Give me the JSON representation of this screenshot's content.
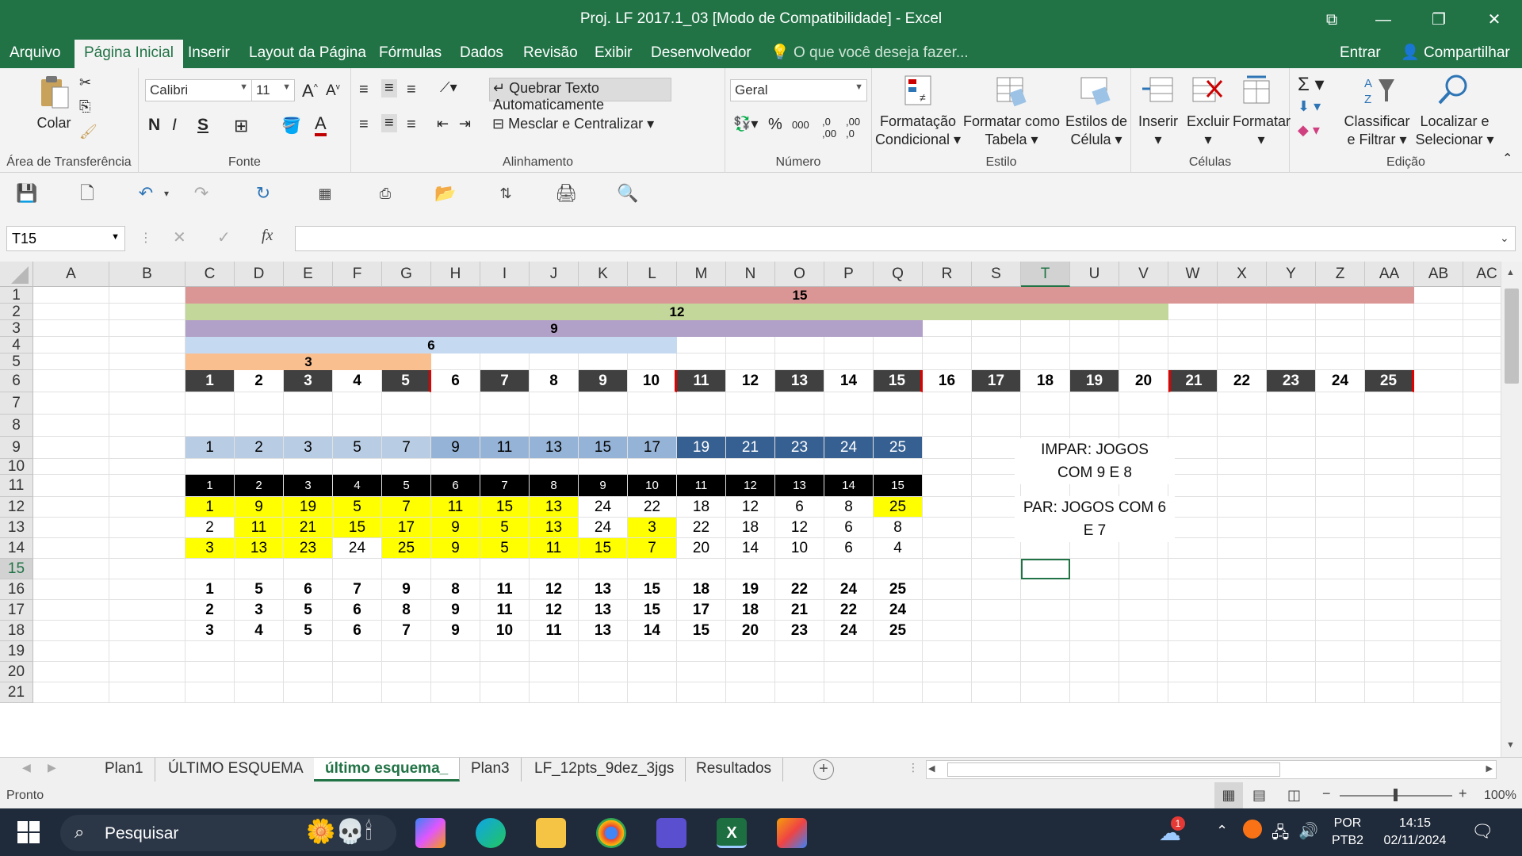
{
  "window": {
    "title": "Proj. LF 2017.1_03  [Modo de Compatibilidade] - Excel"
  },
  "menu": {
    "tabs": [
      "Arquivo",
      "Página Inicial",
      "Inserir",
      "Layout da Página",
      "Fórmulas",
      "Dados",
      "Revisão",
      "Exibir",
      "Desenvolvedor"
    ],
    "search": "O que você deseja fazer...",
    "signin": "Entrar",
    "share": "Compartilhar"
  },
  "ribbon": {
    "paste": "Colar",
    "clipboard_label": "Área de Transferência",
    "font_name": "Calibri",
    "font_size": "11",
    "bold": "N",
    "italic": "I",
    "underline": "S",
    "font_label": "Fonte",
    "wrap_text": "Quebrar Texto Automaticamente",
    "merge_center": "Mesclar e Centralizar",
    "align_label": "Alinhamento",
    "number_format": "Geral",
    "number_label": "Número",
    "cond_format_1": "Formatação",
    "cond_format_2": "Condicional",
    "format_table_1": "Formatar como",
    "format_table_2": "Tabela",
    "cell_styles_1": "Estilos de",
    "cell_styles_2": "Célula",
    "style_label": "Estilo",
    "insert": "Inserir",
    "delete": "Excluir",
    "format": "Formatar",
    "cells_label": "Células",
    "sort_1": "Classificar",
    "sort_2": "e Filtrar",
    "find_1": "Localizar e",
    "find_2": "Selecionar",
    "edit_label": "Edição"
  },
  "formula_bar": {
    "name_box": "T15",
    "fx": "fx",
    "value": ""
  },
  "columns": [
    "A",
    "B",
    "C",
    "D",
    "E",
    "F",
    "G",
    "H",
    "I",
    "J",
    "K",
    "L",
    "M",
    "N",
    "O",
    "P",
    "Q",
    "R",
    "S",
    "T",
    "U",
    "V",
    "W",
    "X",
    "Y",
    "Z",
    "AA",
    "AB",
    "AC"
  ],
  "rows": [
    "1",
    "2",
    "3",
    "4",
    "5",
    "6",
    "7",
    "8",
    "9",
    "10",
    "11",
    "12",
    "13",
    "14",
    "15",
    "16",
    "17",
    "18",
    "19",
    "20",
    "21"
  ],
  "bars": {
    "r1": "15",
    "r2": "12",
    "r3": "9",
    "r4": "6",
    "r5": "3"
  },
  "row6": [
    "1",
    "2",
    "3",
    "4",
    "5",
    "6",
    "7",
    "8",
    "9",
    "10",
    "11",
    "12",
    "13",
    "14",
    "15",
    "16",
    "17",
    "18",
    "19",
    "20",
    "21",
    "22",
    "23",
    "24",
    "25"
  ],
  "row9": [
    "1",
    "2",
    "3",
    "5",
    "7",
    "9",
    "11",
    "13",
    "15",
    "17",
    "19",
    "21",
    "23",
    "24",
    "25"
  ],
  "row11": [
    "1",
    "2",
    "3",
    "4",
    "5",
    "6",
    "7",
    "8",
    "9",
    "10",
    "11",
    "12",
    "13",
    "14",
    "15"
  ],
  "row12": [
    "1",
    "9",
    "19",
    "5",
    "7",
    "11",
    "15",
    "13",
    "24",
    "22",
    "18",
    "12",
    "6",
    "8",
    "25"
  ],
  "row13": [
    "2",
    "11",
    "21",
    "15",
    "17",
    "9",
    "5",
    "13",
    "24",
    "3",
    "22",
    "18",
    "12",
    "6",
    "8"
  ],
  "row14": [
    "3",
    "13",
    "23",
    "24",
    "25",
    "9",
    "5",
    "11",
    "15",
    "7",
    "20",
    "14",
    "10",
    "6",
    "4"
  ],
  "row16": [
    "1",
    "5",
    "6",
    "7",
    "9",
    "8",
    "11",
    "12",
    "13",
    "15",
    "18",
    "19",
    "22",
    "24",
    "25"
  ],
  "row17": [
    "2",
    "3",
    "5",
    "6",
    "8",
    "9",
    "11",
    "12",
    "13",
    "15",
    "17",
    "18",
    "21",
    "22",
    "24"
  ],
  "row18": [
    "3",
    "4",
    "5",
    "6",
    "7",
    "9",
    "10",
    "11",
    "13",
    "14",
    "15",
    "20",
    "23",
    "24",
    "25"
  ],
  "notes": {
    "impar_1": "IMPAR: JOGOS",
    "impar_2": "COM 9 E 8",
    "par_1": "PAR: JOGOS COM 6",
    "par_2": "E 7"
  },
  "sheets": [
    "Plan1",
    "ÚLTIMO ESQUEMA",
    "último esquema_",
    "Plan3",
    "LF_12pts_9dez_3jgs",
    "Resultados"
  ],
  "status": {
    "ready": "Pronto",
    "zoom": "100%"
  },
  "taskbar": {
    "search": "Pesquisar",
    "lang_1": "POR",
    "lang_2": "PTB2",
    "time": "14:15",
    "date": "02/11/2024",
    "badge": "1"
  },
  "colors": {
    "excel_green": "#217346",
    "bar15": "#da9694",
    "bar12": "#c4d79b",
    "bar9": "#b1a0c7",
    "bar6": "#c5d9f1",
    "bar3": "#fabf8f",
    "dark": "#404040",
    "yellow": "#ffff00",
    "blue_light": "#95b3d7",
    "blue_dark": "#366092"
  }
}
